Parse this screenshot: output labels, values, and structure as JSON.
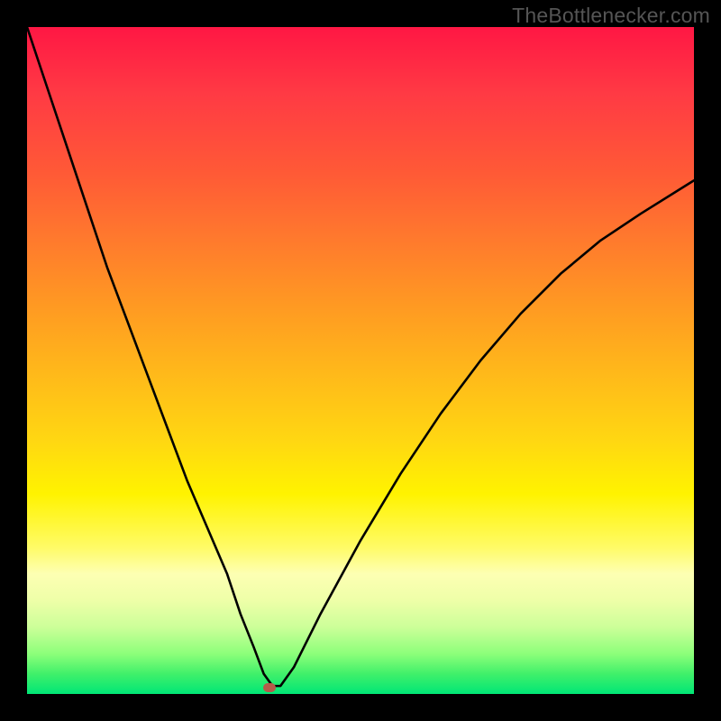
{
  "watermark": "TheBottlenecker.com",
  "chart_data": {
    "type": "line",
    "title": "",
    "xlabel": "",
    "ylabel": "",
    "xlim": [
      0,
      100
    ],
    "ylim": [
      0,
      100
    ],
    "series": [
      {
        "name": "curve",
        "x": [
          0,
          3,
          6,
          9,
          12,
          15,
          18,
          21,
          24,
          27,
          30,
          32,
          34,
          35.5,
          36.8,
          38,
          40,
          44,
          50,
          56,
          62,
          68,
          74,
          80,
          86,
          92,
          100
        ],
        "y": [
          100,
          91,
          82,
          73,
          64,
          56,
          48,
          40,
          32,
          25,
          18,
          12,
          7,
          3,
          1.2,
          1.2,
          4,
          12,
          23,
          33,
          42,
          50,
          57,
          63,
          68,
          72,
          77
        ]
      }
    ],
    "marker": {
      "x": 36.3,
      "y": 1.0
    },
    "gradient_stops": [
      {
        "pos": 0,
        "color": "#ff1744"
      },
      {
        "pos": 50,
        "color": "#ffd712"
      },
      {
        "pos": 80,
        "color": "#fdffb3"
      },
      {
        "pos": 100,
        "color": "#00e676"
      }
    ]
  }
}
